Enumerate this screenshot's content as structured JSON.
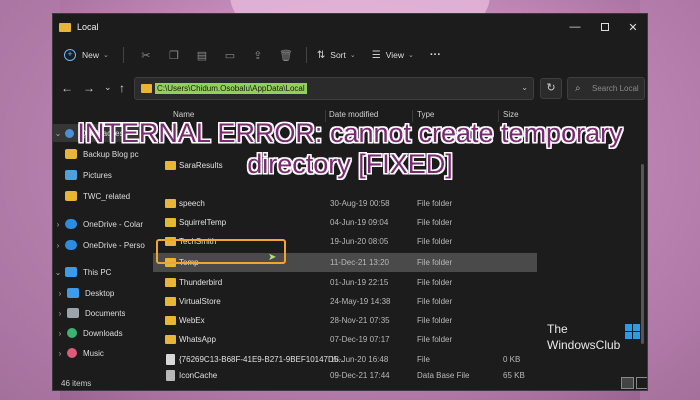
{
  "window": {
    "title": "Local",
    "minimize_glyph": "—",
    "close_glyph": "✕"
  },
  "toolbar": {
    "new_label": "New",
    "sort_label": "Sort",
    "view_label": "View",
    "more_label": "···"
  },
  "nav": {
    "back": "←",
    "forward": "→",
    "up": "↑",
    "recent": "⌄"
  },
  "address": {
    "path": "C:\\Users\\Chidum.Osobalu\\AppData\\Local",
    "chevron": "⌄",
    "refresh": "↻"
  },
  "search": {
    "placeholder": "Search Local"
  },
  "sidebar": {
    "items": [
      {
        "label": "Quick access"
      },
      {
        "label": "Backup Blog pc"
      },
      {
        "label": "Pictures"
      },
      {
        "label": "TWC_related"
      },
      {
        "label": "OneDrive - Colar"
      },
      {
        "label": "OneDrive - Perso"
      },
      {
        "label": "This PC"
      },
      {
        "label": "Desktop"
      },
      {
        "label": "Documents"
      },
      {
        "label": "Downloads"
      },
      {
        "label": "Music"
      }
    ]
  },
  "columns": {
    "name": "Name",
    "date": "Date modified",
    "type": "Type",
    "size": "Size"
  },
  "files": [
    {
      "name": "SaraResults",
      "date": "",
      "type": "",
      "size": ""
    },
    {
      "name": "speech",
      "date": "30-Aug-19 00:58",
      "type": "File folder",
      "size": ""
    },
    {
      "name": "SquirrelTemp",
      "date": "04-Jun-19 09:04",
      "type": "File folder",
      "size": ""
    },
    {
      "name": "TechSmith",
      "date": "19-Jun-20 08:05",
      "type": "File folder",
      "size": ""
    },
    {
      "name": "Temp",
      "date": "11-Dec-21 13:20",
      "type": "File folder",
      "size": ""
    },
    {
      "name": "Thunderbird",
      "date": "01-Jun-19 22:15",
      "type": "File folder",
      "size": ""
    },
    {
      "name": "VirtualStore",
      "date": "24-May-19 14:38",
      "type": "File folder",
      "size": ""
    },
    {
      "name": "WebEx",
      "date": "28-Nov-21 07:35",
      "type": "File folder",
      "size": ""
    },
    {
      "name": "WhatsApp",
      "date": "07-Dec-19 07:17",
      "type": "File folder",
      "size": ""
    },
    {
      "name": "{76269C13-B68F-41E9-B271-9BEF10147D5...",
      "date": "18-Jun-20 16:48",
      "type": "File",
      "size": "0 KB"
    },
    {
      "name": "IconCache",
      "date": "09-Dec-21 17:44",
      "type": "Data Base File",
      "size": "65 KB"
    }
  ],
  "status": {
    "count": "46 items"
  },
  "overlay": {
    "line1": "INTERNAL ERROR: cannot create temporary",
    "line2": "directory [FIXED]"
  },
  "logo": {
    "the": "The",
    "main": "WindowsClub"
  },
  "colors": {
    "accent": "#6cb6ff",
    "folder": "#e8b637",
    "highlight_box": "#f0a431",
    "path_highlight": "#8fd15b",
    "headline": "#7a2a72"
  }
}
